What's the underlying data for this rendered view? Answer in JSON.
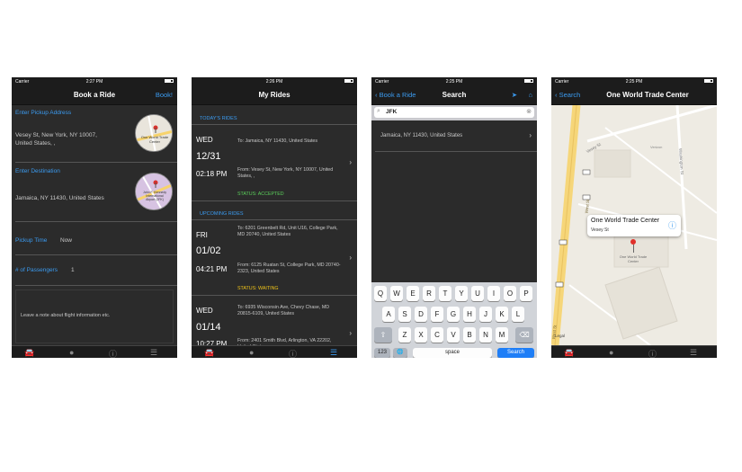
{
  "screen1": {
    "status": {
      "carrier": "Carrier",
      "time": "2:27 PM"
    },
    "title": "Book a Ride",
    "book_label": "Book!",
    "pickup_label": "Enter Pickup Address",
    "pickup_value_line1": "Vesey St, New York, NY  10007,",
    "pickup_value_line2": "United States, ,",
    "pickup_map_label": "One World Trade Center",
    "destination_label": "Enter Destination",
    "destination_value": "Jamaica, NY  11430, United States",
    "destination_map_label": "John F. Kennedy International Airport (JFK)",
    "pickup_time_label": "Pickup Time",
    "pickup_time_value": "Now",
    "passengers_label": "# of Passengers",
    "passengers_value": "1",
    "note_placeholder": "Leave a note about flight information etc."
  },
  "screen2": {
    "status": {
      "time": "2:26 PM"
    },
    "title": "My Rides",
    "today_section": "TODAY'S RIDES",
    "upcoming_section": "UPCOMING RIDES",
    "rides": [
      {
        "day": "WED",
        "date": "12/31",
        "time": "02:18 PM",
        "to": "To: Jamaica, NY  11430, United States",
        "from": "From: Vesey St, New York, NY  10007, United States, ,",
        "status": "STATUS: ACCEPTED"
      },
      {
        "day": "FRI",
        "date": "01/02",
        "time": "04:21 PM",
        "to": "To: 6201 Greenbelt Rd, Unit U16, College Park, MD  20740, United States",
        "from": "From: 6125 Ruatan St, College Park, MD  20740-2323, United States",
        "status": "STATUS: WAITING"
      },
      {
        "day": "WED",
        "date": "01/14",
        "time": "10:27 PM",
        "to": "To: 6935 Wisconsin Ave, Chevy Chase, MD  20815-6109, United States",
        "from": "From: 2401 Smith Blvd, Arlington, VA 22202, United States"
      }
    ]
  },
  "screen3": {
    "status": {
      "carrier": "Carrier",
      "time": "2:25 PM"
    },
    "back_label": "Book a Ride",
    "title": "Search",
    "search_value": "JFK",
    "result": "Jamaica, NY  11430, United States",
    "keys_row1": [
      "Q",
      "W",
      "E",
      "R",
      "T",
      "Y",
      "U",
      "I",
      "O",
      "P"
    ],
    "keys_row2": [
      "A",
      "S",
      "D",
      "F",
      "G",
      "H",
      "J",
      "K",
      "L"
    ],
    "keys_row3": [
      "Z",
      "X",
      "C",
      "V",
      "B",
      "N",
      "M"
    ],
    "space_label": "space",
    "search_key_label": "Search"
  },
  "screen4": {
    "status": {
      "carrier": "Carrier",
      "time": "2:25 PM"
    },
    "back_label": "Search",
    "title": "One World Trade Center",
    "callout_title": "One World Trade Center",
    "callout_subtitle": "Vesey St",
    "pin_label": "One World Trade Center",
    "street_west": "West St",
    "street_vesey": "Vesey St",
    "street_washington": "Washington St",
    "poi_label": "Verizon",
    "legal_label": "Legal"
  }
}
